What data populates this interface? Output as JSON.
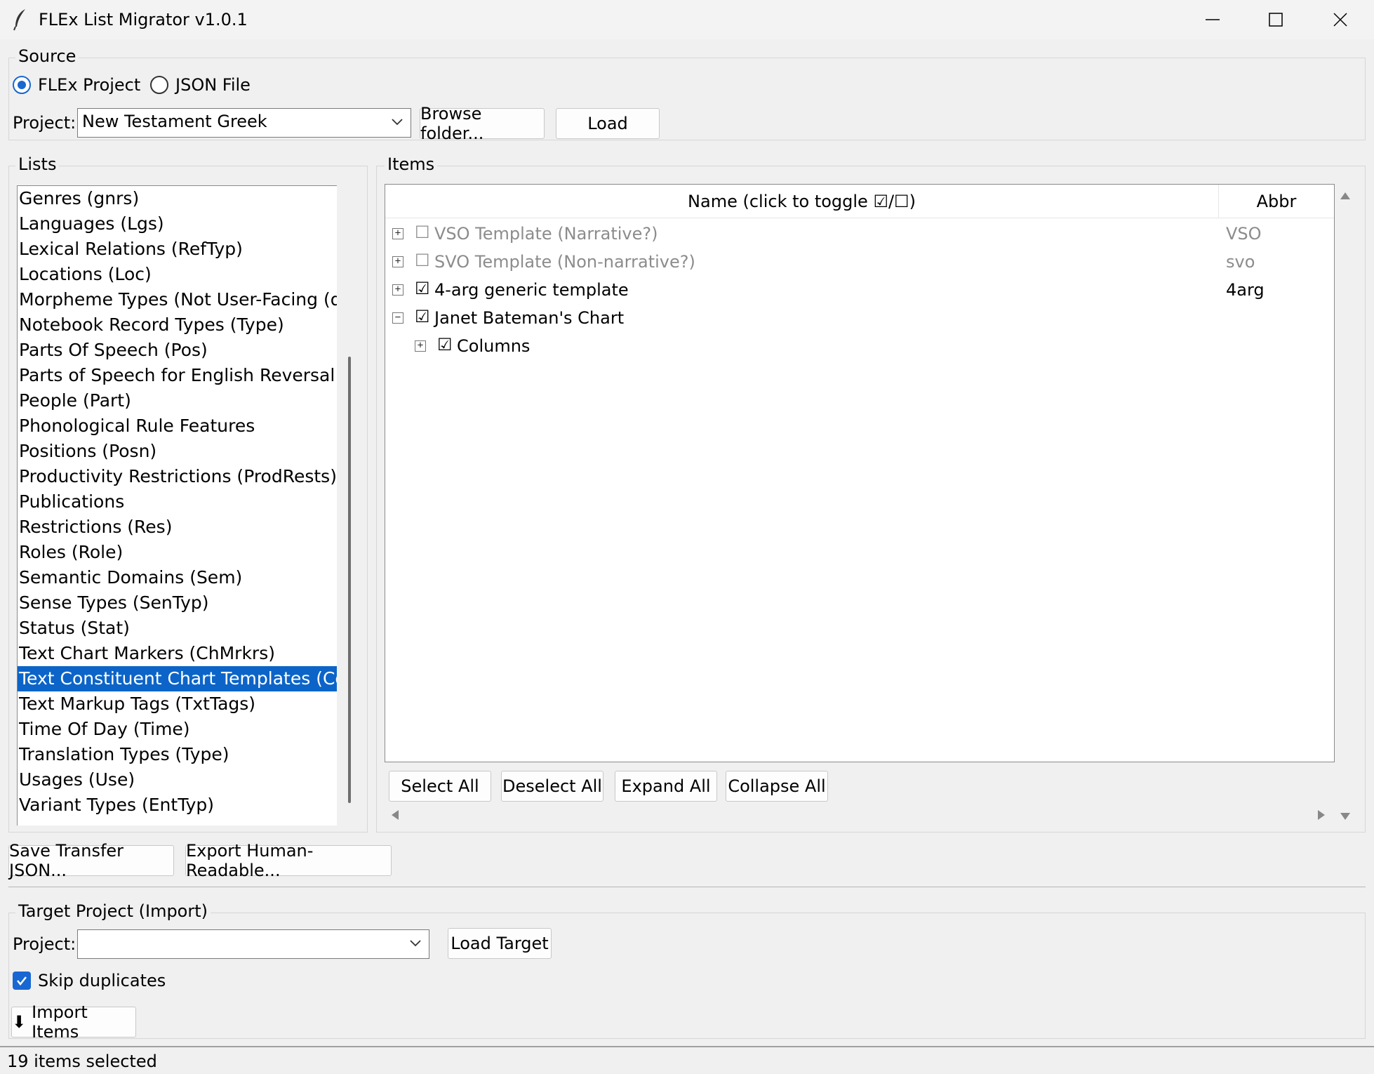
{
  "window": {
    "title": "FLEx List Migrator  v1.0.1"
  },
  "source": {
    "group_label": "Source",
    "radio_flex": "FLEx Project",
    "radio_json": "JSON File",
    "selected": "FLEx Project",
    "project_label": "Project:",
    "project_value": "New Testament Greek",
    "browse_label": "Browse folder...",
    "load_label": "Load"
  },
  "lists": {
    "group_label": "Lists",
    "items": [
      "Genres (gnrs)",
      "Languages (Lgs)",
      "Lexical Relations (RefTyp)",
      "Locations (Loc)",
      "Morpheme Types (Not User-Facing (dc",
      "Notebook Record Types (Type)",
      "Parts Of Speech (Pos)",
      "Parts of Speech for English Reversal In",
      "People (Part)",
      "Phonological Rule Features",
      "Positions (Posn)",
      "Productivity Restrictions (ProdRests)",
      "Publications",
      "Restrictions (Res)",
      "Roles (Role)",
      "Semantic Domains (Sem)",
      "Sense Types (SenTyp)",
      "Status (Stat)",
      "Text Chart Markers (ChMrkrs)",
      "Text Constituent Chart Templates (Con",
      "Text Markup Tags (TxtTags)",
      "Time Of Day (Time)",
      "Translation Types (Type)",
      "Usages (Use)",
      "Variant Types (EntTyp)"
    ],
    "selected_index": 19
  },
  "items": {
    "group_label": "Items",
    "col_name": "Name (click to toggle ☑/☐)",
    "col_abbr": "Abbr",
    "rows": [
      {
        "name": "VSO Template (Narrative?)",
        "abbr": "VSO",
        "checked": false,
        "expander": "⊞",
        "level": 0
      },
      {
        "name": "SVO Template (Non-narrative?)",
        "abbr": "svo",
        "checked": false,
        "expander": "⊞",
        "level": 0
      },
      {
        "name": "4-arg generic template",
        "abbr": "4arg",
        "checked": true,
        "expander": "⊞",
        "level": 0
      },
      {
        "name": "Janet Bateman's Chart",
        "abbr": "",
        "checked": true,
        "expander": "⊟",
        "level": 0
      },
      {
        "name": "Columns",
        "abbr": "",
        "checked": true,
        "expander": "⊞",
        "level": 1
      }
    ],
    "checked_glyph": "☑",
    "unchecked_glyph": "☐",
    "select_all": "Select All",
    "deselect_all": "Deselect All",
    "expand_all": "Expand All",
    "collapse_all": "Collapse All"
  },
  "actions": {
    "save_json": "Save Transfer JSON...",
    "export_human": "Export Human-Readable..."
  },
  "target": {
    "group_label": "Target Project (Import)",
    "project_label": "Project:",
    "project_value": "",
    "load_target": "Load Target",
    "skip_duplicates": "Skip duplicates",
    "skip_checked": true,
    "import_label": "Import Items",
    "import_icon": "⬇"
  },
  "status": {
    "text": "19 items selected"
  },
  "colors": {
    "accent": "#1967d2",
    "selection": "#0c64c8"
  }
}
